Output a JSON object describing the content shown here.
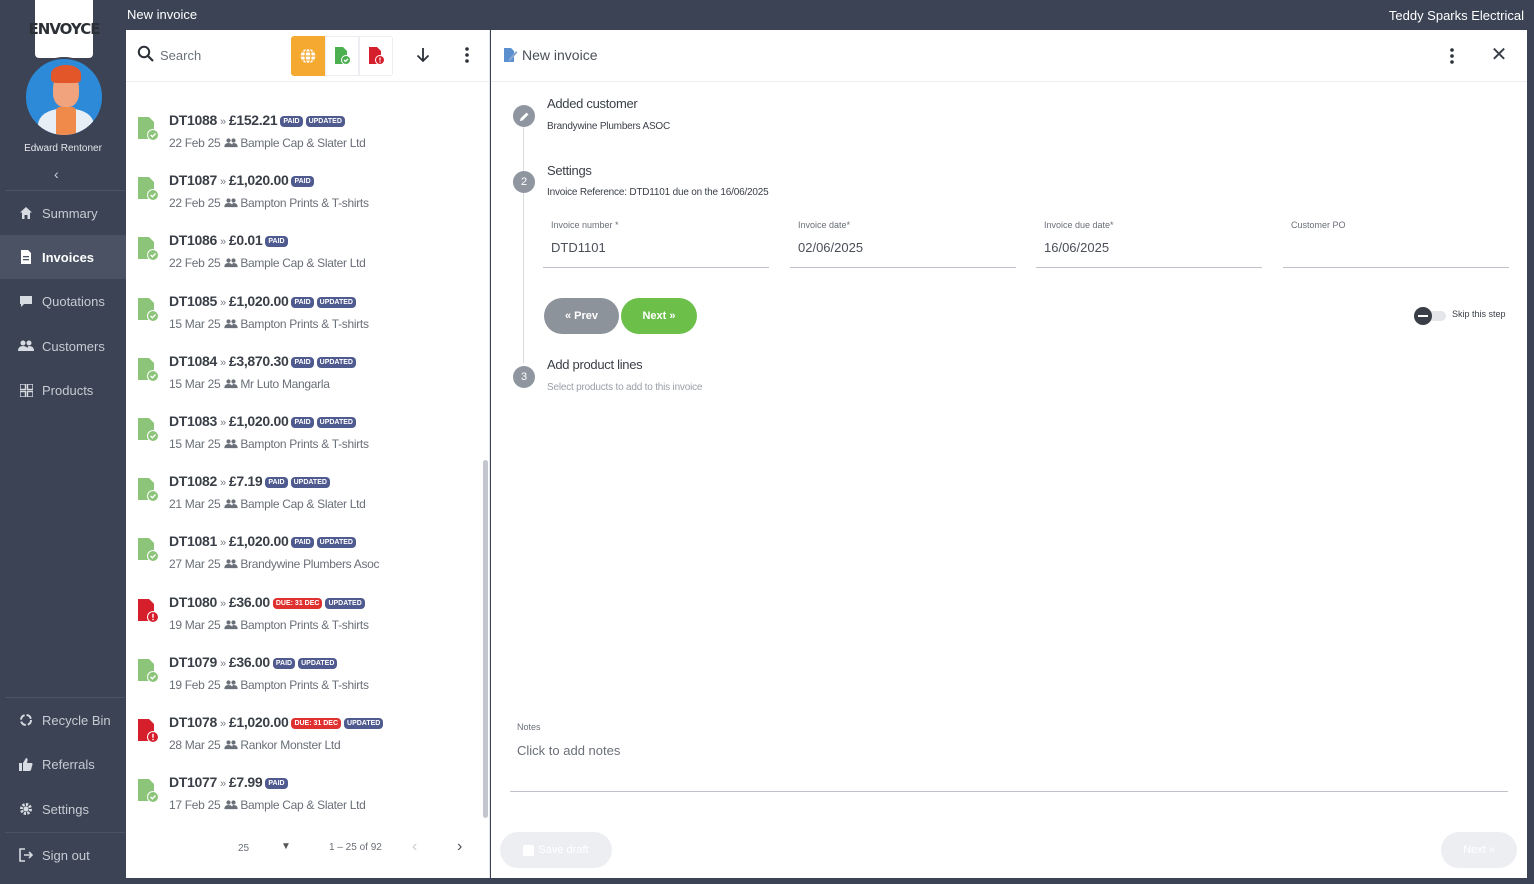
{
  "header": {
    "page_title": "New invoice",
    "company": "Teddy Sparks Electrical"
  },
  "sidebar": {
    "logo": "ENVOYCE",
    "user_name": "Edward Rentoner",
    "collapse_icon": "chevron-left-icon",
    "items": [
      {
        "label": "Summary",
        "icon": "home-icon"
      },
      {
        "label": "Invoices",
        "icon": "invoice-icon",
        "active": true
      },
      {
        "label": "Quotations",
        "icon": "chat-icon"
      },
      {
        "label": "Customers",
        "icon": "people-icon"
      },
      {
        "label": "Products",
        "icon": "grid-icon"
      }
    ],
    "bottom_items": [
      {
        "label": "Recycle Bin",
        "icon": "recycle-icon"
      },
      {
        "label": "Referrals",
        "icon": "thumbs-up-icon"
      },
      {
        "label": "Settings",
        "icon": "gear-icon"
      },
      {
        "label": "Sign out",
        "icon": "sign-out-icon"
      }
    ]
  },
  "list": {
    "search_placeholder": "Search",
    "filters": [
      {
        "name": "all",
        "icon": "globe-icon",
        "active": true
      },
      {
        "name": "paid",
        "icon": "paid-invoice-icon"
      },
      {
        "name": "due",
        "icon": "due-invoice-icon"
      }
    ],
    "invoices": [
      {
        "number": "DT1088",
        "amount": "£152.21",
        "badges": [
          "PAID",
          "UPDATED"
        ],
        "date": "22 Feb 25",
        "customer": "Bample Cap & Slater Ltd",
        "status": "paid"
      },
      {
        "number": "DT1087",
        "amount": "£1,020.00",
        "badges": [
          "PAID"
        ],
        "date": "22 Feb 25",
        "customer": "Bampton Prints & T-shirts",
        "status": "paid"
      },
      {
        "number": "DT1086",
        "amount": "£0.01",
        "badges": [
          "PAID"
        ],
        "date": "22 Feb 25",
        "customer": "Bample Cap & Slater Ltd",
        "status": "paid"
      },
      {
        "number": "DT1085",
        "amount": "£1,020.00",
        "badges": [
          "PAID",
          "UPDATED"
        ],
        "date": "15 Mar 25",
        "customer": "Bampton Prints & T-shirts",
        "status": "paid"
      },
      {
        "number": "DT1084",
        "amount": "£3,870.30",
        "badges": [
          "PAID",
          "UPDATED"
        ],
        "date": "15 Mar 25",
        "customer": "Mr Luto Mangarla",
        "status": "paid"
      },
      {
        "number": "DT1083",
        "amount": "£1,020.00",
        "badges": [
          "PAID",
          "UPDATED"
        ],
        "date": "15 Mar 25",
        "customer": "Bampton Prints & T-shirts",
        "status": "paid"
      },
      {
        "number": "DT1082",
        "amount": "£7.19",
        "badges": [
          "PAID",
          "UPDATED"
        ],
        "date": "21 Mar 25",
        "customer": "Bample Cap & Slater Ltd",
        "status": "paid"
      },
      {
        "number": "DT1081",
        "amount": "£1,020.00",
        "badges": [
          "PAID",
          "UPDATED"
        ],
        "date": "27 Mar 25",
        "customer": "Brandywine Plumbers Asoc",
        "status": "paid"
      },
      {
        "number": "DT1080",
        "amount": "£36.00",
        "badges": [
          "DUE: 31 DEC",
          "UPDATED"
        ],
        "date": "19 Mar 25",
        "customer": "Bampton Prints & T-shirts",
        "status": "due"
      },
      {
        "number": "DT1079",
        "amount": "£36.00",
        "badges": [
          "PAID",
          "UPDATED"
        ],
        "date": "19 Feb 25",
        "customer": "Bampton Prints & T-shirts",
        "status": "paid"
      },
      {
        "number": "DT1078",
        "amount": "£1,020.00",
        "badges": [
          "DUE: 31 DEC",
          "UPDATED"
        ],
        "date": "28 Mar 25",
        "customer": "Rankor Monster Ltd",
        "status": "due"
      },
      {
        "number": "DT1077",
        "amount": "£7.99",
        "badges": [
          "PAID"
        ],
        "date": "17 Feb 25",
        "customer": "Bample Cap & Slater Ltd",
        "status": "paid"
      }
    ],
    "pagination": {
      "page_size": "25",
      "range": "1 – 25 of 92"
    }
  },
  "form": {
    "title": "New invoice",
    "steps": [
      {
        "marker": "",
        "title": "Added customer",
        "subtitle": "Brandywine Plumbers ASOC"
      },
      {
        "marker": "2",
        "title": "Settings",
        "subtitle": "Invoice Reference: DTD1101 due on the 16/06/2025"
      },
      {
        "marker": "3",
        "title": "Add product lines",
        "subtitle": "Select products to add to this invoice"
      }
    ],
    "fields": [
      {
        "label": "Invoice number *",
        "value": "DTD1101"
      },
      {
        "label": "Invoice date*",
        "value": "02/06/2025"
      },
      {
        "label": "Invoice due date*",
        "value": "16/06/2025"
      },
      {
        "label": "Customer PO",
        "value": ""
      }
    ],
    "prev_label": "« Prev",
    "next_label": "Next »",
    "skip_label": "Skip this step",
    "notes_label": "Notes",
    "notes_placeholder": "Click to add notes",
    "save_draft_label": "Save draft",
    "footer_next_label": "Next »"
  },
  "colors": {
    "sidebar_bg": "#3b4354",
    "accent_orange": "#f5a931",
    "paid_green": "#8cc57a",
    "due_red": "#d61f2c",
    "next_green": "#6cc04a",
    "badge_blue": "#4f5a8f"
  }
}
